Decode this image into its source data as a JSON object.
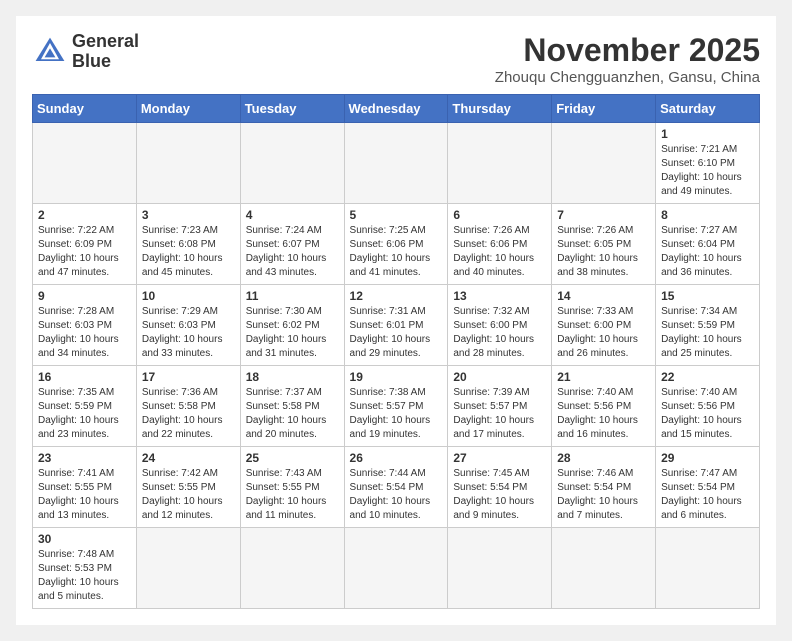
{
  "logo": {
    "line1": "General",
    "line2": "Blue"
  },
  "title": "November 2025",
  "subtitle": "Zhouqu Chengguanzhen, Gansu, China",
  "days_of_week": [
    "Sunday",
    "Monday",
    "Tuesday",
    "Wednesday",
    "Thursday",
    "Friday",
    "Saturday"
  ],
  "weeks": [
    [
      {
        "day": "",
        "info": ""
      },
      {
        "day": "",
        "info": ""
      },
      {
        "day": "",
        "info": ""
      },
      {
        "day": "",
        "info": ""
      },
      {
        "day": "",
        "info": ""
      },
      {
        "day": "",
        "info": ""
      },
      {
        "day": "1",
        "info": "Sunrise: 7:21 AM\nSunset: 6:10 PM\nDaylight: 10 hours and 49 minutes."
      }
    ],
    [
      {
        "day": "2",
        "info": "Sunrise: 7:22 AM\nSunset: 6:09 PM\nDaylight: 10 hours and 47 minutes."
      },
      {
        "day": "3",
        "info": "Sunrise: 7:23 AM\nSunset: 6:08 PM\nDaylight: 10 hours and 45 minutes."
      },
      {
        "day": "4",
        "info": "Sunrise: 7:24 AM\nSunset: 6:07 PM\nDaylight: 10 hours and 43 minutes."
      },
      {
        "day": "5",
        "info": "Sunrise: 7:25 AM\nSunset: 6:06 PM\nDaylight: 10 hours and 41 minutes."
      },
      {
        "day": "6",
        "info": "Sunrise: 7:26 AM\nSunset: 6:06 PM\nDaylight: 10 hours and 40 minutes."
      },
      {
        "day": "7",
        "info": "Sunrise: 7:26 AM\nSunset: 6:05 PM\nDaylight: 10 hours and 38 minutes."
      },
      {
        "day": "8",
        "info": "Sunrise: 7:27 AM\nSunset: 6:04 PM\nDaylight: 10 hours and 36 minutes."
      }
    ],
    [
      {
        "day": "9",
        "info": "Sunrise: 7:28 AM\nSunset: 6:03 PM\nDaylight: 10 hours and 34 minutes."
      },
      {
        "day": "10",
        "info": "Sunrise: 7:29 AM\nSunset: 6:03 PM\nDaylight: 10 hours and 33 minutes."
      },
      {
        "day": "11",
        "info": "Sunrise: 7:30 AM\nSunset: 6:02 PM\nDaylight: 10 hours and 31 minutes."
      },
      {
        "day": "12",
        "info": "Sunrise: 7:31 AM\nSunset: 6:01 PM\nDaylight: 10 hours and 29 minutes."
      },
      {
        "day": "13",
        "info": "Sunrise: 7:32 AM\nSunset: 6:00 PM\nDaylight: 10 hours and 28 minutes."
      },
      {
        "day": "14",
        "info": "Sunrise: 7:33 AM\nSunset: 6:00 PM\nDaylight: 10 hours and 26 minutes."
      },
      {
        "day": "15",
        "info": "Sunrise: 7:34 AM\nSunset: 5:59 PM\nDaylight: 10 hours and 25 minutes."
      }
    ],
    [
      {
        "day": "16",
        "info": "Sunrise: 7:35 AM\nSunset: 5:59 PM\nDaylight: 10 hours and 23 minutes."
      },
      {
        "day": "17",
        "info": "Sunrise: 7:36 AM\nSunset: 5:58 PM\nDaylight: 10 hours and 22 minutes."
      },
      {
        "day": "18",
        "info": "Sunrise: 7:37 AM\nSunset: 5:58 PM\nDaylight: 10 hours and 20 minutes."
      },
      {
        "day": "19",
        "info": "Sunrise: 7:38 AM\nSunset: 5:57 PM\nDaylight: 10 hours and 19 minutes."
      },
      {
        "day": "20",
        "info": "Sunrise: 7:39 AM\nSunset: 5:57 PM\nDaylight: 10 hours and 17 minutes."
      },
      {
        "day": "21",
        "info": "Sunrise: 7:40 AM\nSunset: 5:56 PM\nDaylight: 10 hours and 16 minutes."
      },
      {
        "day": "22",
        "info": "Sunrise: 7:40 AM\nSunset: 5:56 PM\nDaylight: 10 hours and 15 minutes."
      }
    ],
    [
      {
        "day": "23",
        "info": "Sunrise: 7:41 AM\nSunset: 5:55 PM\nDaylight: 10 hours and 13 minutes."
      },
      {
        "day": "24",
        "info": "Sunrise: 7:42 AM\nSunset: 5:55 PM\nDaylight: 10 hours and 12 minutes."
      },
      {
        "day": "25",
        "info": "Sunrise: 7:43 AM\nSunset: 5:55 PM\nDaylight: 10 hours and 11 minutes."
      },
      {
        "day": "26",
        "info": "Sunrise: 7:44 AM\nSunset: 5:54 PM\nDaylight: 10 hours and 10 minutes."
      },
      {
        "day": "27",
        "info": "Sunrise: 7:45 AM\nSunset: 5:54 PM\nDaylight: 10 hours and 9 minutes."
      },
      {
        "day": "28",
        "info": "Sunrise: 7:46 AM\nSunset: 5:54 PM\nDaylight: 10 hours and 7 minutes."
      },
      {
        "day": "29",
        "info": "Sunrise: 7:47 AM\nSunset: 5:54 PM\nDaylight: 10 hours and 6 minutes."
      }
    ],
    [
      {
        "day": "30",
        "info": "Sunrise: 7:48 AM\nSunset: 5:53 PM\nDaylight: 10 hours and 5 minutes."
      },
      {
        "day": "",
        "info": ""
      },
      {
        "day": "",
        "info": ""
      },
      {
        "day": "",
        "info": ""
      },
      {
        "day": "",
        "info": ""
      },
      {
        "day": "",
        "info": ""
      },
      {
        "day": "",
        "info": ""
      }
    ]
  ]
}
